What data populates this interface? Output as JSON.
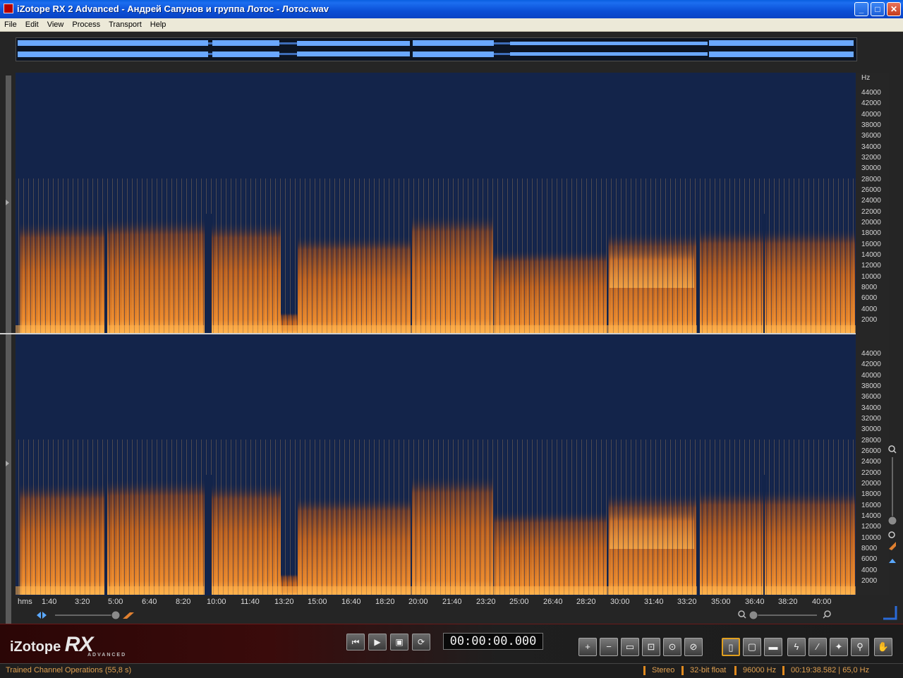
{
  "window": {
    "title": "iZotope RX 2 Advanced - Андрей Сапунов и группа Лотос - Лотос.wav",
    "minimize": "_",
    "maximize": "□",
    "close": "✕"
  },
  "menu": [
    "File",
    "Edit",
    "View",
    "Process",
    "Transport",
    "Help"
  ],
  "frequency_axis": {
    "unit": "Hz",
    "labels": [
      "44000",
      "42000",
      "40000",
      "38000",
      "36000",
      "34000",
      "32000",
      "30000",
      "28000",
      "26000",
      "24000",
      "22000",
      "20000",
      "18000",
      "16000",
      "14000",
      "12000",
      "10000",
      "8000",
      "6000",
      "4000",
      "2000"
    ]
  },
  "time_axis": {
    "unit": "hms",
    "labels": [
      "1:40",
      "3:20",
      "5:00",
      "6:40",
      "8:20",
      "10:00",
      "11:40",
      "13:20",
      "15:00",
      "16:40",
      "18:20",
      "20:00",
      "21:40",
      "23:20",
      "25:00",
      "26:40",
      "28:20",
      "30:00",
      "31:40",
      "33:20",
      "35:00",
      "36:40",
      "38:20",
      "40:00"
    ]
  },
  "brand": {
    "name": "iZotope",
    "product": "RX",
    "edition": "ADVANCED"
  },
  "transport": {
    "buttons": [
      "to-start",
      "play",
      "play-selection",
      "loop"
    ],
    "timecode": "00:00:00.000"
  },
  "tools": [
    "zoom-in",
    "zoom-out",
    "zoom-fit",
    "zoom-selection",
    "zoom-time",
    "zoom-frequency",
    "time-selection",
    "time-frequency-selection",
    "frequency-selection",
    "lasso",
    "brush",
    "magic-wand",
    "zoom-tool",
    "hand-tool"
  ],
  "status": {
    "message": "Trained Channel Operations (55,8 s)",
    "channels": "Stereo",
    "bit_depth": "32-bit float",
    "sample_rate": "96000 Hz",
    "cursor": "00:19:38.582 | 65,0 Hz"
  },
  "colors": {
    "spectrogram_background": "#13244a",
    "spectrogram_energy": "#e88a2a",
    "waveform": "#6aa8ff",
    "status_text": "#e0a050"
  }
}
